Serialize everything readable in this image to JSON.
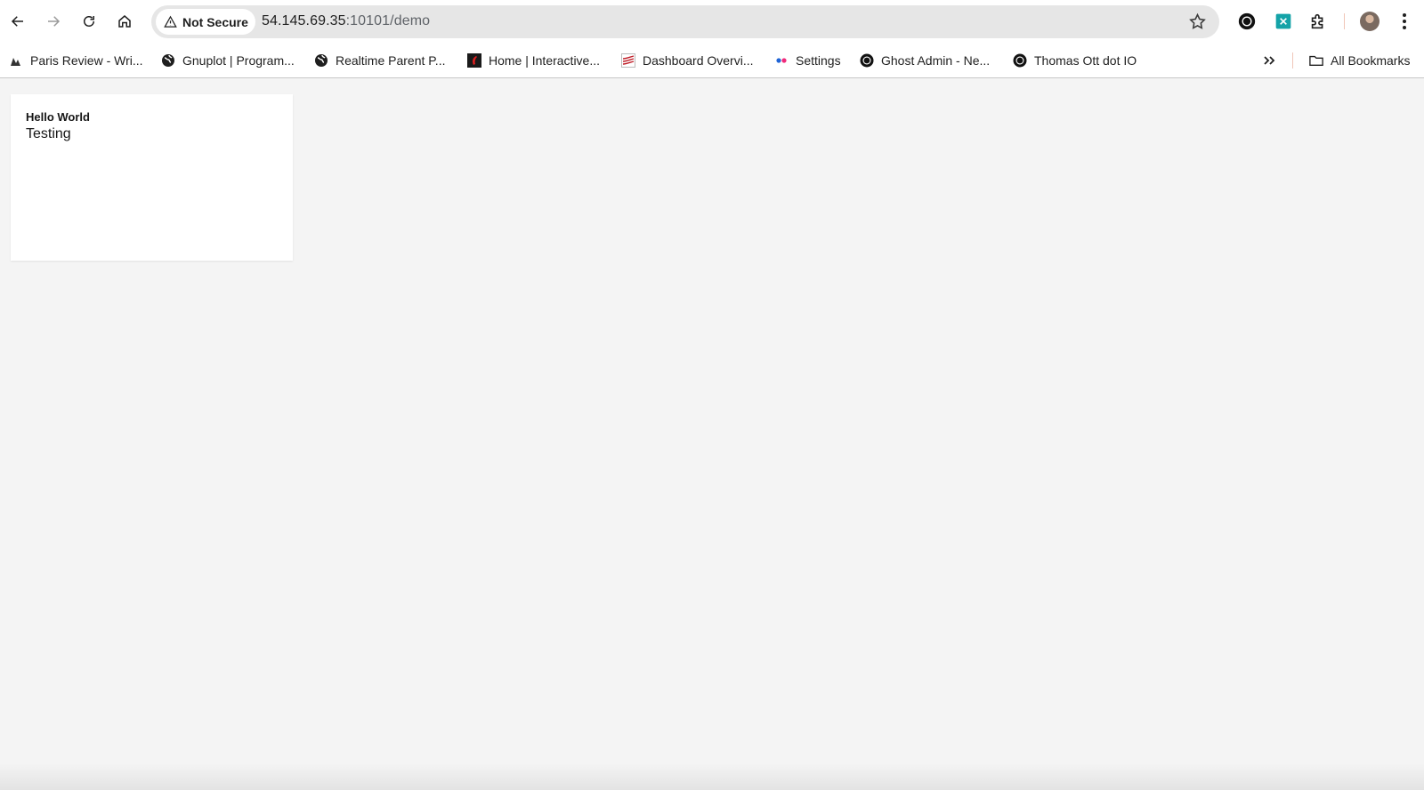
{
  "browser": {
    "security_label": "Not Secure",
    "url_host": "54.145.69.35",
    "url_rest": ":10101/demo"
  },
  "bookmarks": [
    {
      "label": "Paris Review - Wri...",
      "icon": "paris-review-icon"
    },
    {
      "label": "Gnuplot | Program...",
      "icon": "globe-icon"
    },
    {
      "label": "Realtime Parent P...",
      "icon": "globe-icon"
    },
    {
      "label": "Home | Interactive...",
      "icon": "interactive-icon"
    },
    {
      "label": "Dashboard Overvi...",
      "icon": "dashboard-icon"
    },
    {
      "label": "Settings",
      "icon": "flickr-icon"
    },
    {
      "label": "Ghost Admin - Ne...",
      "icon": "ghost-icon"
    },
    {
      "label": "Thomas Ott dot IO",
      "icon": "ghost-icon"
    }
  ],
  "all_bookmarks_label": "All Bookmarks",
  "card": {
    "title": "Hello World",
    "subtitle": "Testing"
  },
  "colors": {
    "page_background": "#f4f4f4",
    "card_background": "#ffffff",
    "extension_teal": "#14a3a8"
  }
}
